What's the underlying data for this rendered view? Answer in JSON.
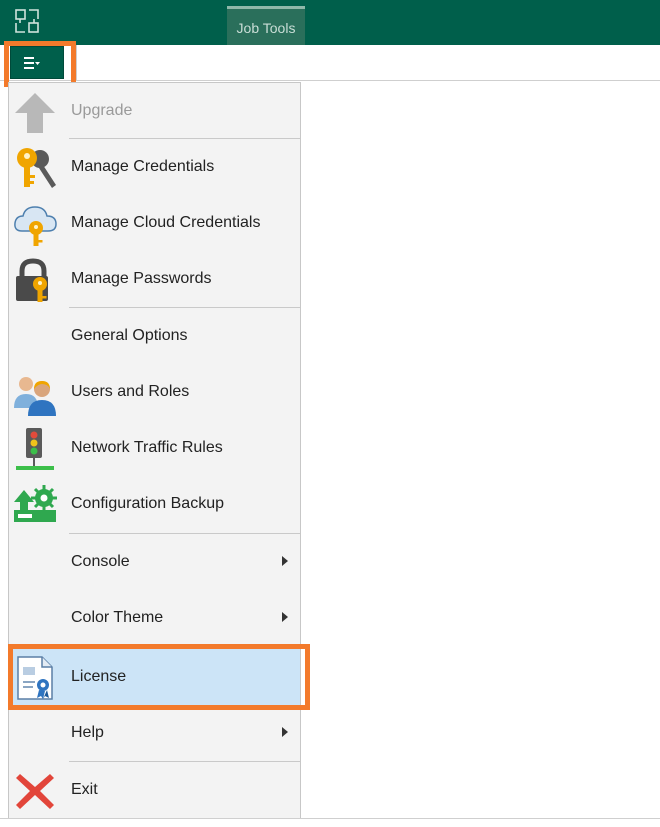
{
  "titlebar": {
    "tab_label": "Job Tools"
  },
  "menu": {
    "items": [
      {
        "label": "Upgrade",
        "icon": "upgrade-arrow-icon",
        "disabled": true
      },
      {
        "label": "Manage Credentials",
        "icon": "keys-icon"
      },
      {
        "label": "Manage Cloud Credentials",
        "icon": "cloud-key-icon"
      },
      {
        "label": "Manage Passwords",
        "icon": "lock-key-icon"
      },
      {
        "label": "General Options",
        "icon": ""
      },
      {
        "label": "Users and Roles",
        "icon": "users-icon"
      },
      {
        "label": "Network Traffic Rules",
        "icon": "traffic-light-icon"
      },
      {
        "label": "Configuration Backup",
        "icon": "config-backup-icon"
      },
      {
        "label": "Console",
        "icon": "",
        "submenu": true
      },
      {
        "label": "Color Theme",
        "icon": "",
        "submenu": true
      },
      {
        "label": "License",
        "icon": "license-icon",
        "selected": true
      },
      {
        "label": "Help",
        "icon": "",
        "submenu": true
      },
      {
        "label": "Exit",
        "icon": "exit-x-icon"
      }
    ]
  },
  "colors": {
    "titlebar": "#005f4b",
    "highlight": "#f37a2b",
    "selected": "#cce4f7",
    "menu_bg": "#f3f3f3"
  }
}
